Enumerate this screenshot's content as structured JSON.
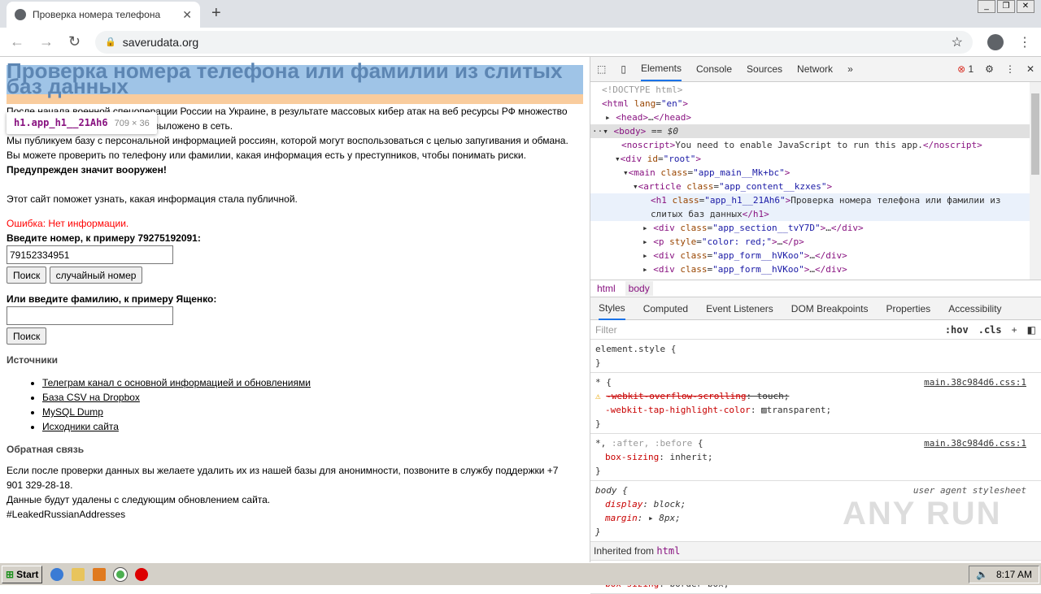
{
  "browser": {
    "tab_title": "Проверка номера телефона",
    "url": "saverudata.org"
  },
  "page": {
    "title": "Проверка номера телефона или фамилии из слитых баз данных",
    "tooltip": {
      "selector": "h1.app_h1__21Ah6",
      "size": "709 × 36"
    },
    "intro_line1": "После начала военной спецоперации России на Украине, в результате массовых кибер атак на веб ресурсы РФ множество",
    "intro_line2": "выложено в сеть.",
    "intro_p2": "Мы публикуем базу с персональной информацией россиян, которой могут воспользоваться с целью запугивания и обмана.",
    "intro_p3": "Вы можете проверить по телефону или фамилии, какая информация есть у преступников, чтобы понимать риски.",
    "warning": "Предупрежден значит вооружен!",
    "intro_p4": "Этот сайт поможет узнать, какая информация стала публичной.",
    "error": "Ошибка: Нет информации.",
    "phone_label": "Введите номер, к примеру 79275192091:",
    "phone_value": "79152334951",
    "search_label": "Поиск",
    "random_label": "случайный номер",
    "surname_label": "Или введите фамилию, к примеру Ященко:",
    "surname_value": "",
    "search2_label": "Поиск",
    "sources_title": "Источники",
    "sources": [
      "Телеграм канал с основной информацией и обновлениями",
      "База CSV на Dropbox",
      "MySQL Dump",
      "Исходники сайта"
    ],
    "feedback_title": "Обратная связь",
    "feedback_p1": "Если после проверки данных вы желаете удалить их из нашей базы для анонимности, позвоните в службу поддержки +7",
    "feedback_p1b": "901 329-28-18.",
    "feedback_p2": "Данные будут удалены с следующим обновлением сайта.",
    "hashtag": "#LeakedRussianAddresses"
  },
  "devtools": {
    "tabs": [
      "Elements",
      "Console",
      "Sources",
      "Network"
    ],
    "error_count": "1",
    "crumbs": [
      "html",
      "body"
    ],
    "subtabs": [
      "Styles",
      "Computed",
      "Event Listeners",
      "DOM Breakpoints",
      "Properties",
      "Accessibility"
    ],
    "filter_placeholder": "Filter",
    "hov": ":hov",
    "cls": ".cls",
    "src": "main.38c984d6.css:1",
    "ua": "user agent stylesheet",
    "inherited": "Inherited from",
    "inherited_tag": "html",
    "noscript_text": "You need to enable JavaScript to run this app.",
    "h1_text_1": "Проверка номера телефона или фамилии из",
    "h1_text_2": "слитых баз данных"
  },
  "taskbar": {
    "start": "Start",
    "time": "8:17 AM"
  },
  "watermark": "ANY RUN"
}
